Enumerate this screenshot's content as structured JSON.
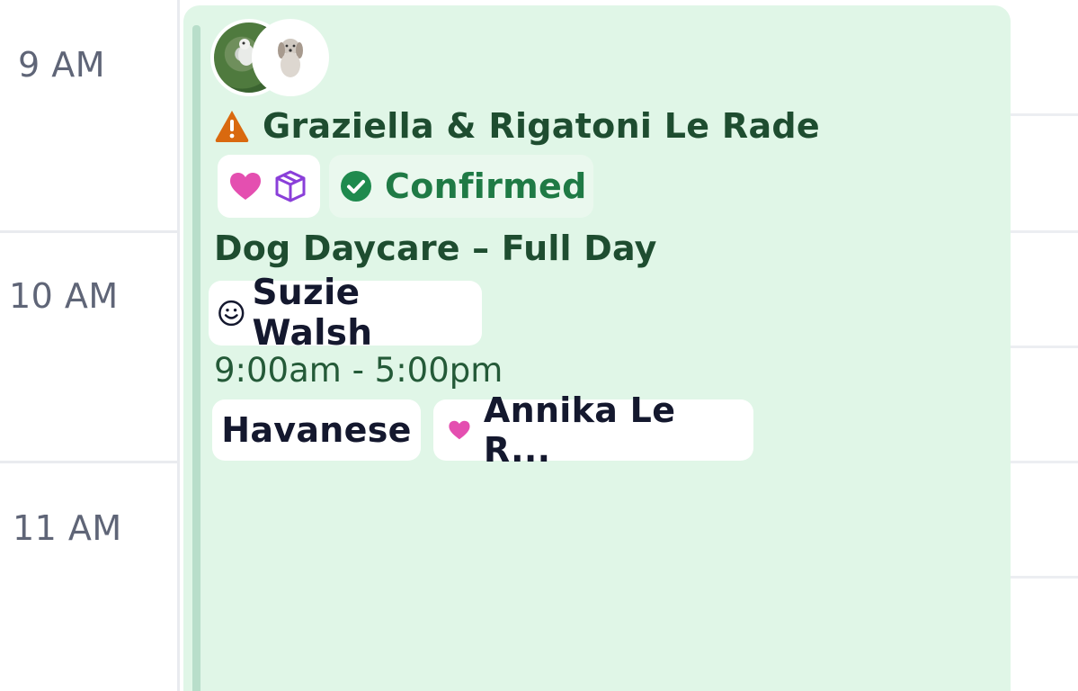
{
  "time_gutter": {
    "hours": [
      "9 AM",
      "10 AM",
      "11 AM"
    ]
  },
  "event": {
    "avatars": [
      "dog-photo-avatar",
      "dog-illustration-avatar"
    ],
    "warning_icon": "warning-triangle-icon",
    "pet_name": "Graziella & Rigatoni Le Rade",
    "badge_icons": [
      "heart-icon",
      "package-icon"
    ],
    "status": {
      "icon": "check-circle-icon",
      "label": "Confirmed"
    },
    "service": "Dog Daycare – Full Day",
    "staff": {
      "icon": "smiley-icon",
      "name": "Suzie Walsh"
    },
    "time_range": "9:00am - 5:00pm",
    "tags": {
      "breed": "Havanese",
      "owner_icon": "heart-icon",
      "owner": "Annika Le R..."
    }
  },
  "colors": {
    "event_background": "#e0f6e7",
    "event_accent": "#b8deca",
    "event_text": "#1e4d30",
    "status_green": "#1f7a45",
    "warning_orange": "#d9690f",
    "heart_pink": "#e44fb0",
    "package_purple": "#8a3fd9"
  }
}
